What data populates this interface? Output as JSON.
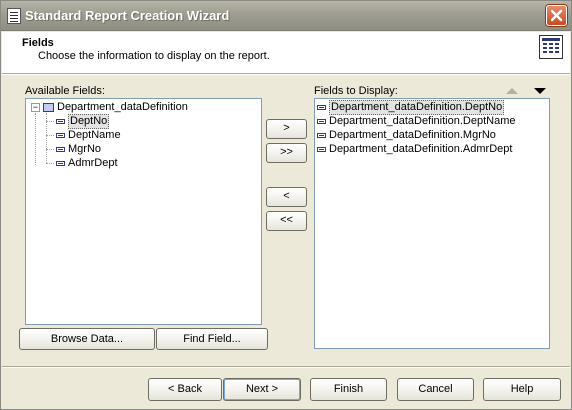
{
  "window": {
    "title": "Standard Report Creation Wizard"
  },
  "header": {
    "title": "Fields",
    "subtitle": "Choose the information to display on the report."
  },
  "available": {
    "label": "Available Fields:",
    "root": "Department_dataDefinition",
    "items": [
      "DeptNo",
      "DeptName",
      "MgrNo",
      "AdmrDept"
    ],
    "selected": "DeptNo"
  },
  "display": {
    "label": "Fields to Display:",
    "items": [
      "Department_dataDefinition.DeptNo",
      "Department_dataDefinition.DeptName",
      "Department_dataDefinition.MgrNo",
      "Department_dataDefinition.AdmrDept"
    ]
  },
  "transfer": {
    "add": ">",
    "add_all": ">>",
    "remove": "<",
    "remove_all": "<<"
  },
  "tools": {
    "browse": "Browse Data...",
    "find": "Find Field..."
  },
  "footer": {
    "back": "< Back",
    "next": "Next >",
    "finish": "Finish",
    "cancel": "Cancel",
    "help": "Help"
  },
  "icons": {
    "app": "report-icon",
    "close": "close-icon",
    "header": "table-icon",
    "tree_root": "database-icon",
    "field": "field-icon",
    "sort_up": "triangle-up-icon",
    "sort_down": "triangle-down-icon"
  },
  "colors": {
    "titlebar": "#a09f93",
    "close": "#c84a23",
    "dialog": "#ece9d8",
    "list_border": "#7f9db9"
  }
}
